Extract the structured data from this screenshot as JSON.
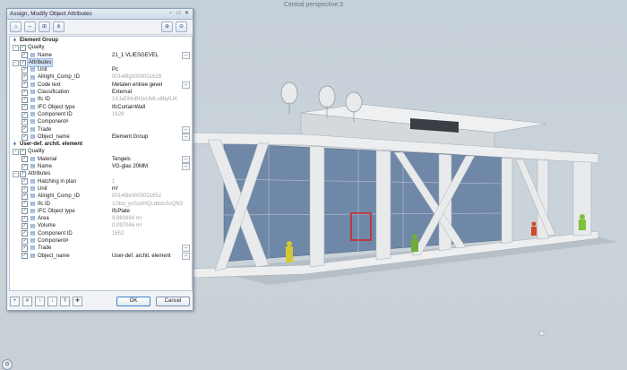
{
  "viewport": {
    "title": "Central perspective:3"
  },
  "dialog": {
    "title": "Assign, Modify Object Attributes",
    "window_buttons": {
      "minimize": "▫",
      "maximize": "□",
      "close": "✕"
    },
    "groups": [
      {
        "label": "Element Group",
        "sections": [
          {
            "label": "Quality",
            "selected": false,
            "rows": [
              {
                "label": "Name",
                "value": "21_1 VLIESGEVEL",
                "grey": false,
                "more": true
              }
            ]
          },
          {
            "label": "Attributes",
            "selected": true,
            "rows": [
              {
                "label": "Unit",
                "value": "Pc",
                "grey": false,
                "more": false
              },
              {
                "label": "Allright_Comp_ID",
                "value": "00146fg0000001628",
                "grey": true,
                "more": false
              },
              {
                "label": "Code text",
                "value": "Metalen entree gevel",
                "grey": false,
                "more": true
              },
              {
                "label": "Classification",
                "value": "External",
                "grey": false,
                "more": false
              },
              {
                "label": "Ifc ID",
                "value": "1XJaDNnBt3xUMLv8by5JK",
                "grey": true,
                "more": false
              },
              {
                "label": "IFC Object type",
                "value": "IfcCurtainWall",
                "grey": false,
                "more": false
              },
              {
                "label": "Component ID",
                "value": "1628",
                "grey": true,
                "more": false
              },
              {
                "label": "Component#",
                "value": "",
                "grey": false,
                "more": false
              },
              {
                "label": "Trade",
                "value": "",
                "grey": false,
                "more": true
              },
              {
                "label": "Object_name",
                "value": "Element Group",
                "grey": false,
                "more": true
              }
            ]
          }
        ]
      },
      {
        "label": "User-def. archit. element",
        "sections": [
          {
            "label": "Quality",
            "selected": false,
            "rows": [
              {
                "label": "Material",
                "value": "Tengels",
                "grey": false,
                "more": true
              },
              {
                "label": "Name",
                "value": "VG-glas 20MM",
                "grey": false,
                "more": true
              }
            ]
          },
          {
            "label": "Attributes",
            "selected": false,
            "rows": [
              {
                "label": "Hatching in plan",
                "value": "1",
                "grey": true,
                "more": false
              },
              {
                "label": "Unit",
                "value": "m²",
                "grey": false,
                "more": false
              },
              {
                "label": "Allright_Comp_ID",
                "value": "00146fe0000001652",
                "grey": true,
                "more": false
              },
              {
                "label": "Ifc ID",
                "value": "1Gbd_yvSsdHQLdddcSsQN3",
                "grey": true,
                "more": false
              },
              {
                "label": "IFC Object type",
                "value": "IfcPlate",
                "grey": false,
                "more": false
              },
              {
                "label": "Area",
                "value": "9.860884 m²",
                "grey": true,
                "more": false
              },
              {
                "label": "Volume",
                "value": "0.097046 m³",
                "grey": true,
                "more": false
              },
              {
                "label": "Component ID",
                "value": "1652",
                "grey": true,
                "more": false
              },
              {
                "label": "Component#",
                "value": "",
                "grey": false,
                "more": false
              },
              {
                "label": "Trade",
                "value": "",
                "grey": false,
                "more": true
              },
              {
                "label": "Object_name",
                "value": "User-def. archit. element",
                "grey": false,
                "more": true
              }
            ]
          }
        ]
      }
    ],
    "ok_label": "OK",
    "cancel_label": "Cancel"
  },
  "colors": {
    "accent": "#3a7fc4",
    "selection": "#cfe0f4",
    "building": "#e6e8ea"
  }
}
